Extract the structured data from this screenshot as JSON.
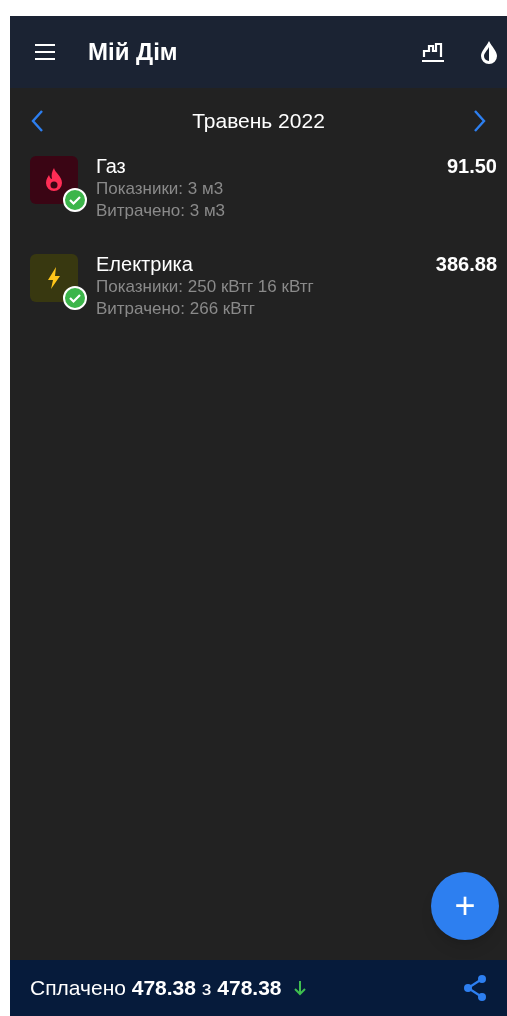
{
  "app_bar": {
    "title": "Мій Дім"
  },
  "month_nav": {
    "label": "Травень 2022"
  },
  "utilities": [
    {
      "kind": "gas",
      "name": "Газ",
      "readings": "Показники: 3 м3",
      "used": "Витрачено: 3 м3",
      "amount": "91.50",
      "paid": true
    },
    {
      "kind": "electric",
      "name": "Електрика",
      "readings": "Показники: 250 кВтг 16 кВтг",
      "used": "Витрачено: 266 кВтг",
      "amount": "386.88",
      "paid": true
    }
  ],
  "fab": {
    "label": "+"
  },
  "footer": {
    "summary": "Сплачено **478.38** з **478.38**"
  }
}
